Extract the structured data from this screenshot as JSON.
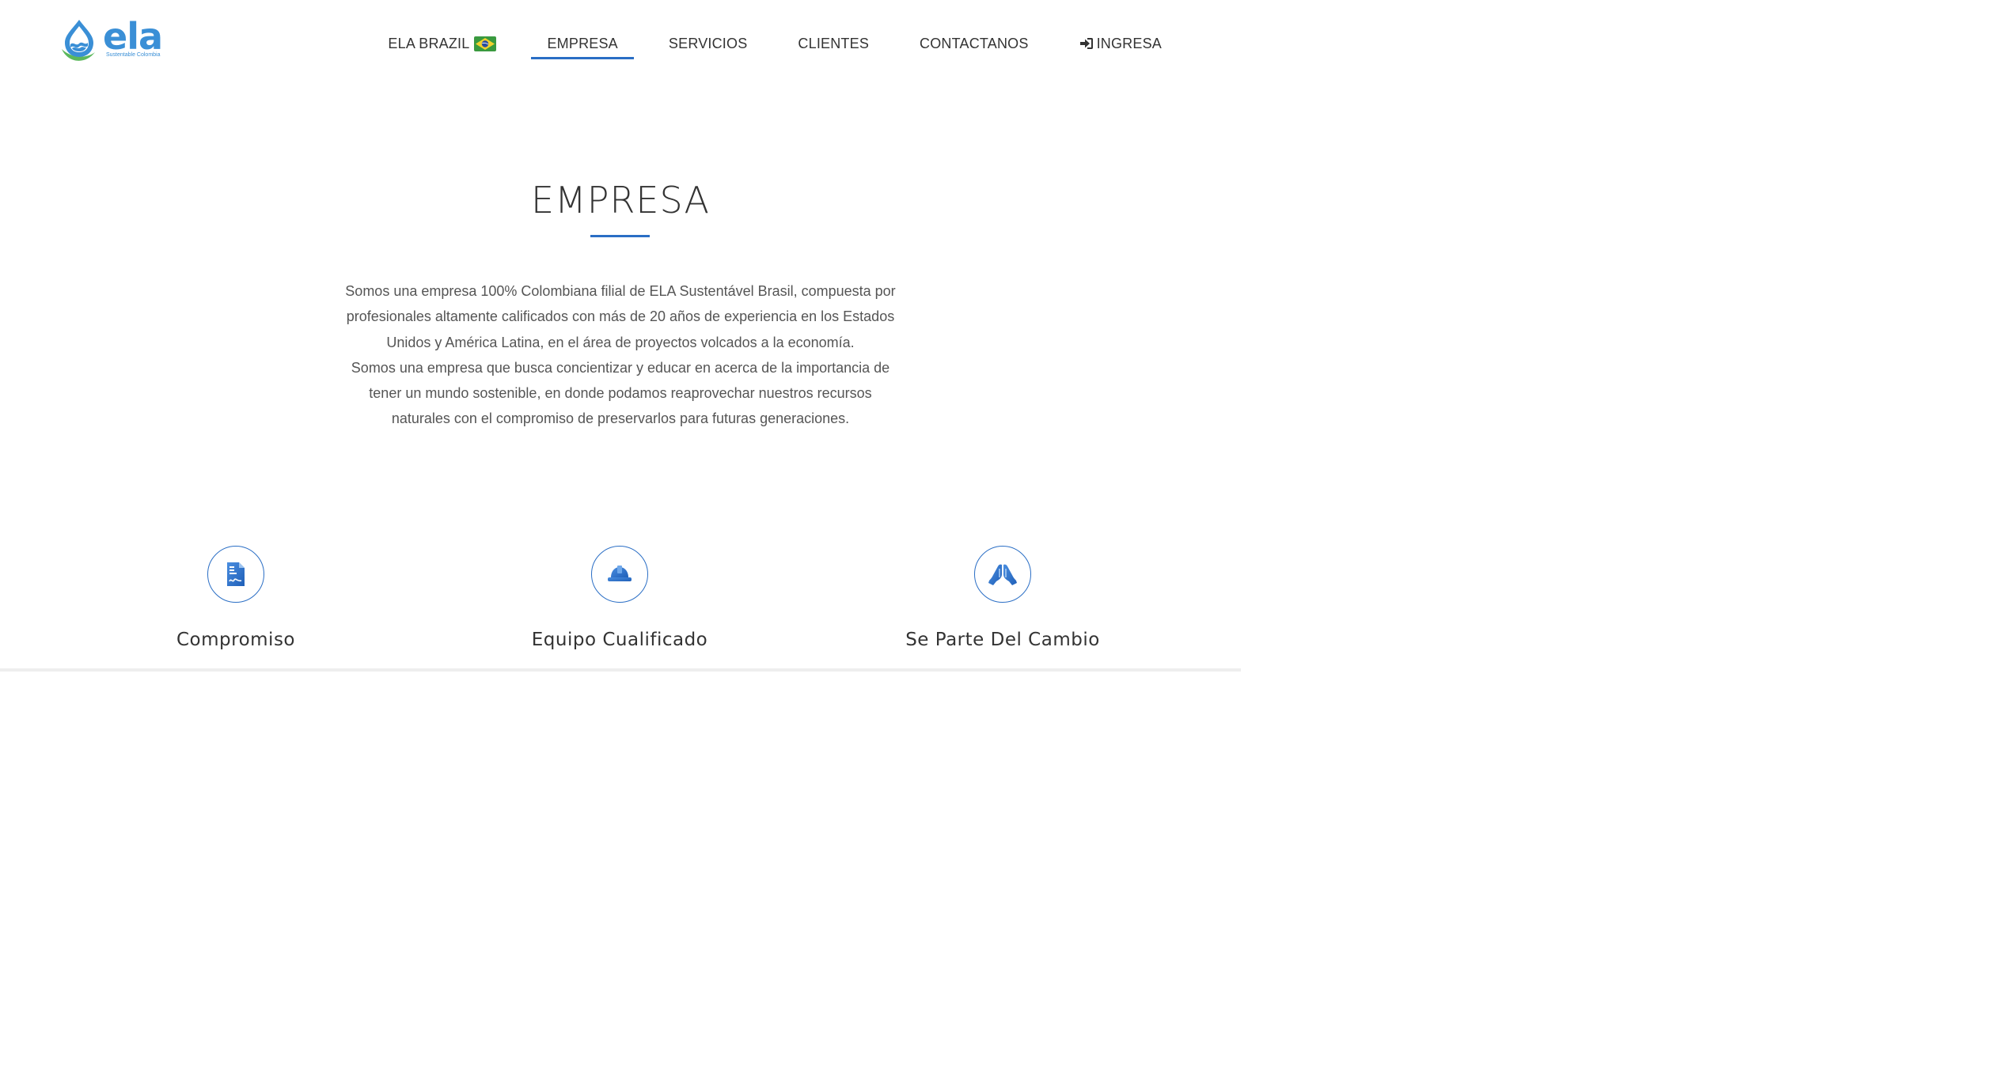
{
  "logo": {
    "wordmark": "ela",
    "tagline": "Sustentable Colombia",
    "brand_color": "#3a8fd6",
    "leaf_color": "#5cb85c"
  },
  "nav": {
    "items": [
      {
        "label": "ELA BRAZIL",
        "icon": "brazil-flag-icon",
        "active": false
      },
      {
        "label": "EMPRESA",
        "active": true
      },
      {
        "label": "SERVICIOS",
        "active": false
      },
      {
        "label": "CLIENTES",
        "active": false
      },
      {
        "label": "CONTACTANOS",
        "active": false
      },
      {
        "label": "INGRESA",
        "icon": "sign-in-icon",
        "active": false
      }
    ],
    "active_color": "#2a6ec5"
  },
  "main": {
    "title": "EMPRESA",
    "paragraphs": [
      "Somos una empresa 100% Colombiana filial de ELA Sustentável Brasil, compuesta por profesionales altamente calificados con más de 20 años de experiencia en los Estados Unidos y América Latina, en el área de proyectos volcados a la economía.",
      "Somos una empresa que busca concientizar y educar en acerca de la importancia de tener un mundo sostenible, en donde podamos reaprovechar nuestros recursos naturales con el compromiso de preservarlos para futuras generaciones."
    ]
  },
  "features": [
    {
      "title": "Compromiso",
      "icon": "contract-document-icon"
    },
    {
      "title": "Equipo Cualificado",
      "icon": "hard-hat-icon"
    },
    {
      "title": "Se Parte Del Cambio",
      "icon": "praying-hands-icon"
    }
  ]
}
